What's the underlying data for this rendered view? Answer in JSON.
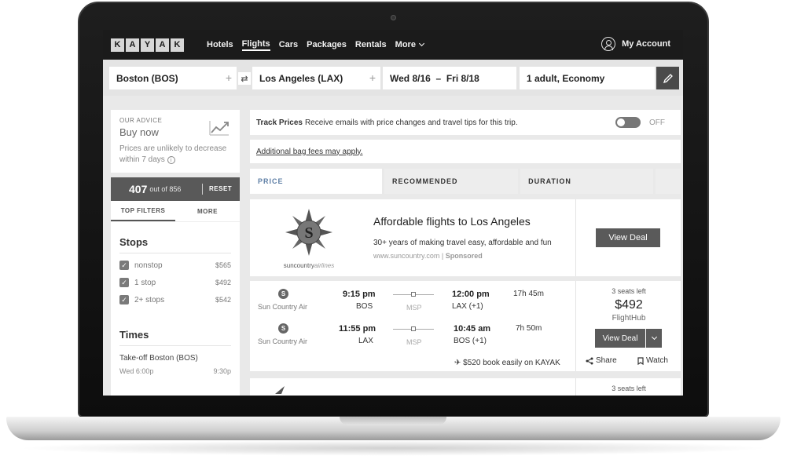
{
  "brand": {
    "logo_letters": [
      "K",
      "A",
      "Y",
      "A",
      "K"
    ]
  },
  "nav": {
    "items": [
      {
        "label": "Hotels"
      },
      {
        "label": "Flights"
      },
      {
        "label": "Cars"
      },
      {
        "label": "Packages"
      },
      {
        "label": "Rentals"
      },
      {
        "label": "More"
      }
    ],
    "active": "Flights",
    "account_label": "My Account"
  },
  "search": {
    "origin": "Boston (BOS)",
    "destination": "Los Angeles (LAX)",
    "dates": "Wed 8/16  –  Fri 8/18",
    "travelers": "1 adult, Economy"
  },
  "advice": {
    "label": "OUR ADVICE",
    "title": "Buy now",
    "text": "Prices are unlikely to decrease within 7 days"
  },
  "results": {
    "count": "407",
    "of_text": "out of 856",
    "reset_label": "RESET"
  },
  "filter_tabs": [
    "TOP FILTERS",
    "MORE"
  ],
  "stops": {
    "title": "Stops",
    "options": [
      {
        "label": "nonstop",
        "price": "$565",
        "checked": true
      },
      {
        "label": "1 stop",
        "price": "$492",
        "checked": true
      },
      {
        "label": "2+ stops",
        "price": "$542",
        "checked": true
      }
    ]
  },
  "times": {
    "title": "Times",
    "takeoff_label": "Take-off Boston (BOS)",
    "range_start": "Wed 6:00p",
    "range_end": "9:30p"
  },
  "track_prices": {
    "title": "Track Prices",
    "text": "Receive emails with price changes and travel tips for this trip.",
    "toggle_state": "OFF"
  },
  "bag_fees": "Additional bag fees may apply.",
  "sort_tabs": [
    "PRICE",
    "RECOMMENDED",
    "DURATION"
  ],
  "ad": {
    "logo_text": "suncountry",
    "logo_text2": "airlines",
    "title": "Affordable flights to Los Angeles",
    "description": "30+ years of making travel easy, affordable and fun",
    "url": "www.suncountry.com",
    "sponsored": "Sponsored",
    "button": "View Deal"
  },
  "flights": [
    {
      "legs": [
        {
          "airline": "Sun Country Air",
          "dep_time": "9:15 pm",
          "dep_code": "BOS",
          "via": "MSP",
          "arr_time": "12:00 pm",
          "arr_code": "LAX (+1)",
          "duration": "17h 45m"
        },
        {
          "airline": "Sun Country Air",
          "dep_time": "11:55 pm",
          "dep_code": "LAX",
          "via": "MSP",
          "arr_time": "10:45 am",
          "arr_code": "BOS (+1)",
          "duration": "7h 50m"
        }
      ],
      "book_text": "$520 book easily on KAYAK",
      "seats": "3 seats left",
      "price": "$492",
      "provider": "FlightHub",
      "button": "View Deal",
      "share": "Share",
      "watch": "Watch"
    },
    {
      "seats": "3 seats left"
    }
  ]
}
